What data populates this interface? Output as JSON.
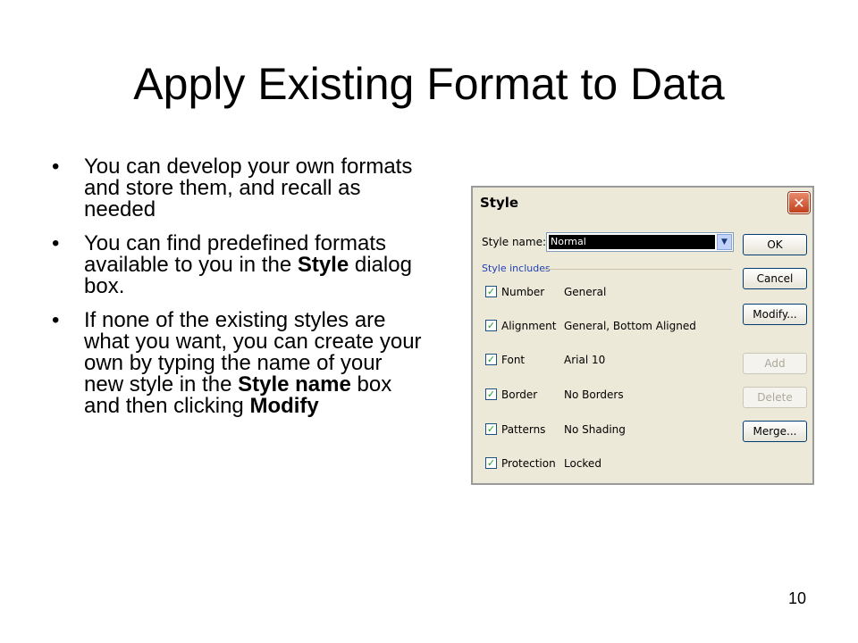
{
  "slide": {
    "title": "Apply Existing Format to Data",
    "bullets": [
      [
        "You can develop your own formats and store them, and recall as needed"
      ],
      [
        "You can find predefined formats available to you in the ",
        "Style",
        " dialog box."
      ],
      [
        "If none of the existing styles are what you want, you can create your own by typing the name of your new style in the ",
        "Style name",
        " box and then clicking ",
        "Modify"
      ]
    ],
    "page_number": "10"
  },
  "dialog": {
    "title": "Style",
    "close_glyph": "✕",
    "style_name_label": "Style name:",
    "style_name_value": "Normal",
    "dropdown_glyph": "▼",
    "includes_label": "Style includes",
    "check_glyph": "✓",
    "rows": [
      {
        "label": "Number",
        "value": "General",
        "checked": true
      },
      {
        "label": "Alignment",
        "value": "General, Bottom Aligned",
        "checked": true
      },
      {
        "label": "Font",
        "value": "Arial 10",
        "checked": true
      },
      {
        "label": "Border",
        "value": "No Borders",
        "checked": true
      },
      {
        "label": "Patterns",
        "value": "No Shading",
        "checked": true
      },
      {
        "label": "Protection",
        "value": "Locked",
        "checked": true
      }
    ],
    "buttons": {
      "ok": "OK",
      "cancel": "Cancel",
      "modify": "Modify...",
      "add": "Add",
      "delete": "Delete",
      "merge": "Merge..."
    }
  }
}
